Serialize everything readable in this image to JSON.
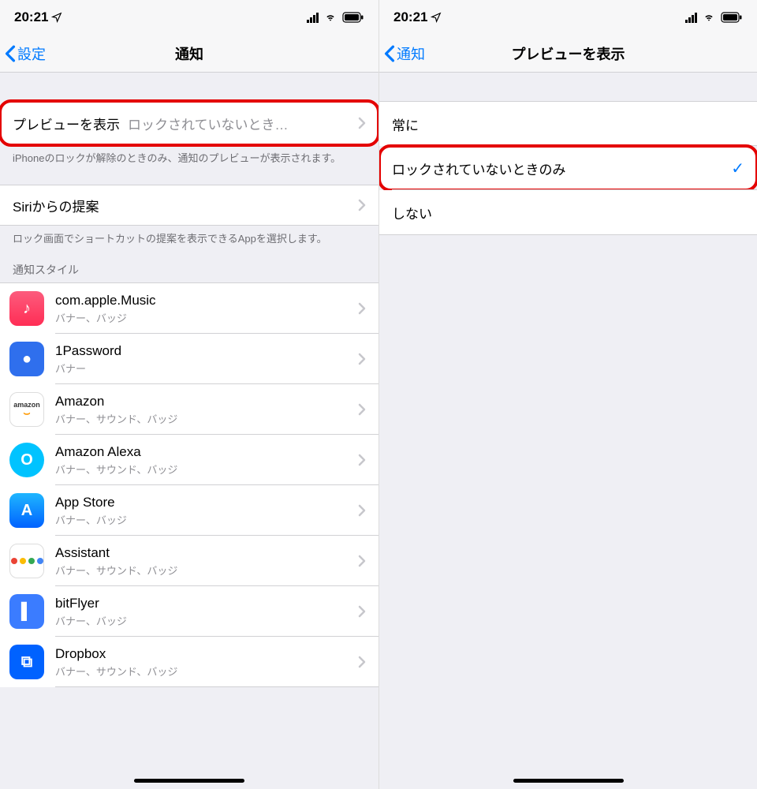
{
  "left": {
    "statusbar": {
      "time": "20:21"
    },
    "nav": {
      "back": "設定",
      "title": "通知"
    },
    "preview": {
      "label": "プレビューを表示",
      "value": "ロックされていないとき…"
    },
    "preview_footer": "iPhoneのロックが解除のときのみ、通知のプレビューが表示されます。",
    "siri": {
      "label": "Siriからの提案"
    },
    "siri_footer": "ロック画面でショートカットの提案を表示できるAppを選択します。",
    "style_header": "通知スタイル",
    "apps": [
      {
        "name": "com.apple.Music",
        "sub": "バナー、バッジ",
        "icon": "icon-music",
        "glyph": "♪"
      },
      {
        "name": "1Password",
        "sub": "バナー",
        "icon": "icon-1pw",
        "glyph": "●"
      },
      {
        "name": "Amazon",
        "sub": "バナー、サウンド、バッジ",
        "icon": "icon-amazon",
        "glyph": "amazon"
      },
      {
        "name": "Amazon Alexa",
        "sub": "バナー、サウンド、バッジ",
        "icon": "icon-alexa",
        "glyph": "O"
      },
      {
        "name": "App Store",
        "sub": "バナー、バッジ",
        "icon": "icon-appstore",
        "glyph": "A"
      },
      {
        "name": "Assistant",
        "sub": "バナー、サウンド、バッジ",
        "icon": "icon-assist",
        "glyph": ""
      },
      {
        "name": "bitFlyer",
        "sub": "バナー、バッジ",
        "icon": "icon-bitflyer",
        "glyph": "▌"
      },
      {
        "name": "Dropbox",
        "sub": "バナー、サウンド、バッジ",
        "icon": "icon-dropbox",
        "glyph": "⧉"
      }
    ]
  },
  "right": {
    "statusbar": {
      "time": "20:21"
    },
    "nav": {
      "back": "通知",
      "title": "プレビューを表示"
    },
    "options": [
      {
        "label": "常に",
        "selected": false,
        "highlight": false
      },
      {
        "label": "ロックされていないときのみ",
        "selected": true,
        "highlight": true
      },
      {
        "label": "しない",
        "selected": false,
        "highlight": false
      }
    ]
  }
}
